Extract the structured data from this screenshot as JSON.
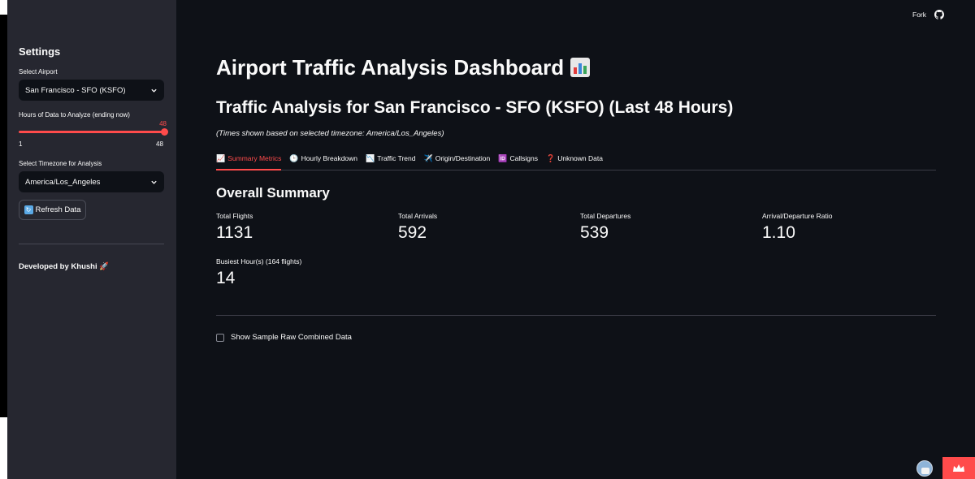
{
  "topbar": {
    "fork_label": "Fork"
  },
  "sidebar": {
    "title": "Settings",
    "airport_label": "Select Airport",
    "airport_value": "San Francisco - SFO (KSFO)",
    "hours_label": "Hours of Data to Analyze (ending now)",
    "hours_value": "48",
    "hours_min": "1",
    "hours_max": "48",
    "timezone_label": "Select Timezone for Analysis",
    "timezone_value": "America/Los_Angeles",
    "refresh_label": "Refresh Data",
    "footer": "Developed by Khushi 🚀"
  },
  "main": {
    "title": "Airport Traffic Analysis Dashboard",
    "subtitle": "Traffic Analysis for San Francisco - SFO (KSFO) (Last 48 Hours)",
    "caption": "(Times shown based on selected timezone: America/Los_Angeles)",
    "tabs": [
      {
        "icon": "📈",
        "label": "Summary Metrics"
      },
      {
        "icon": "🕒",
        "label": "Hourly Breakdown"
      },
      {
        "icon": "📉",
        "label": "Traffic Trend"
      },
      {
        "icon": "✈️",
        "label": "Origin/Destination"
      },
      {
        "icon": "🆔",
        "label": "Callsigns"
      },
      {
        "icon": "❓",
        "label": "Unknown Data"
      }
    ],
    "section_title": "Overall Summary",
    "metrics": [
      {
        "label": "Total Flights",
        "value": "1131"
      },
      {
        "label": "Total Arrivals",
        "value": "592"
      },
      {
        "label": "Total Departures",
        "value": "539"
      },
      {
        "label": "Arrival/Departure Ratio",
        "value": "1.10"
      },
      {
        "label": "Busiest Hour(s) (164 flights)",
        "value": "14"
      }
    ],
    "checkbox_label": "Show Sample Raw Combined Data"
  },
  "colors": {
    "accent": "#ff4b4b",
    "background": "#0e1117",
    "sidebar": "#262730"
  }
}
